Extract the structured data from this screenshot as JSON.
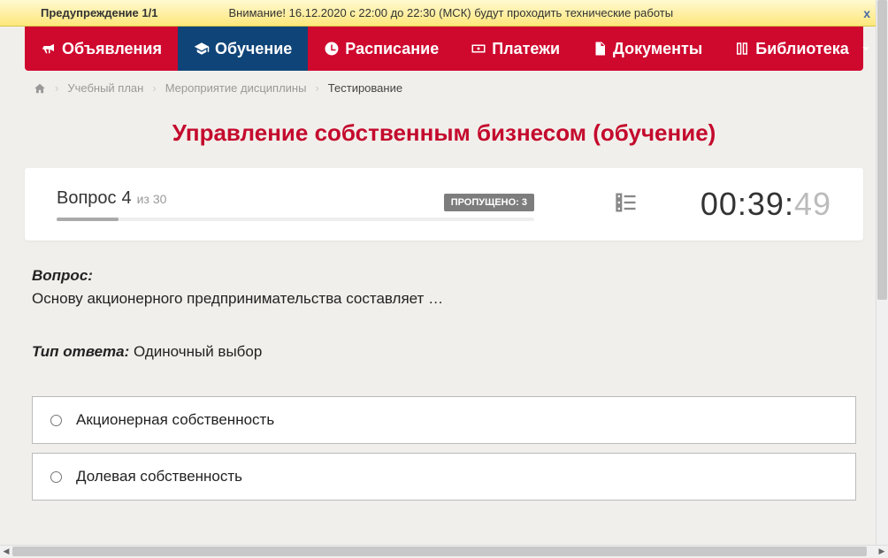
{
  "warning": {
    "label": "Предупреждение 1/1",
    "text": "Внимание! 16.12.2020 c 22:00 до 22:30 (МСК) будут проходить технические работы",
    "close": "x"
  },
  "nav": {
    "announcements": "Объявления",
    "learning": "Обучение",
    "schedule": "Расписание",
    "payments": "Платежи",
    "documents": "Документы",
    "library": "Библиотека"
  },
  "breadcrumb": {
    "plan": "Учебный план",
    "event": "Мероприятие дисциплины",
    "testing": "Тестирование"
  },
  "page_title": "Управление собственным бизнесом (обучение)",
  "quiz": {
    "question_word": "Вопрос",
    "question_num": "4",
    "of_word": "из",
    "total": "30",
    "skipped_label": "ПРОПУЩЕНО: 3",
    "timer_main": "00:39:",
    "timer_sec": "49"
  },
  "question": {
    "label": "Вопрос:",
    "text": "Основу акционерного предпринимательства составляет …",
    "answer_type_label": "Тип ответа:",
    "answer_type": "Одиночный выбор"
  },
  "answers": [
    {
      "label": "Акционерная собственность"
    },
    {
      "label": "Долевая собственность"
    }
  ]
}
